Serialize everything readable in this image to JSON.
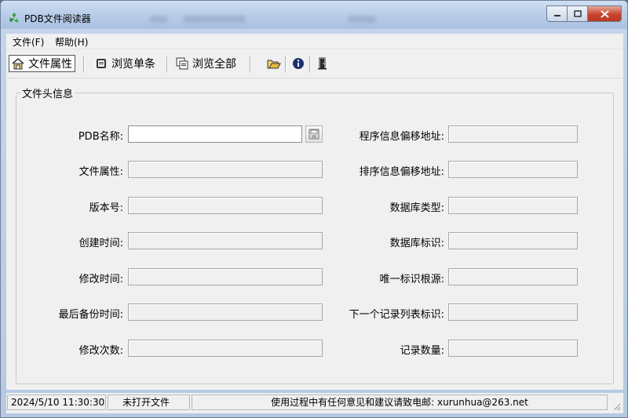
{
  "window": {
    "title": "PDB文件阅读器"
  },
  "menu": {
    "file": "文件(F)",
    "help": "帮助(H)"
  },
  "toolbar": {
    "file_attr": "文件属性",
    "browse_single": "浏览单条",
    "browse_all": "浏览全部"
  },
  "group": {
    "title": "文件头信息"
  },
  "left_fields": [
    {
      "label": "PDB名称:",
      "value": ""
    },
    {
      "label": "文件属性:",
      "value": ""
    },
    {
      "label": "版本号:",
      "value": ""
    },
    {
      "label": "创建时间:",
      "value": ""
    },
    {
      "label": "修改时间:",
      "value": ""
    },
    {
      "label": "最后备份时间:",
      "value": ""
    },
    {
      "label": "修改次数:",
      "value": ""
    }
  ],
  "right_fields": [
    {
      "label": "程序信息偏移地址:",
      "value": ""
    },
    {
      "label": "排序信息偏移地址:",
      "value": ""
    },
    {
      "label": "数据库类型:",
      "value": ""
    },
    {
      "label": "数据库标识:",
      "value": ""
    },
    {
      "label": "唯一标识根源:",
      "value": ""
    },
    {
      "label": "下一个记录列表标识:",
      "value": ""
    },
    {
      "label": "记录数量:",
      "value": ""
    }
  ],
  "status": {
    "datetime": "2024/5/10 11:30:30",
    "file_state": "未打开文件",
    "message": "使用过程中有任何意见和建议请致电邮: xurunhua@263.net"
  },
  "icons": [
    "recycle-icon",
    "minimize-icon",
    "maximize-icon",
    "close-icon",
    "file-attr-icon",
    "single-record-icon",
    "all-records-icon",
    "open-folder-icon",
    "info-icon",
    "exit-icon",
    "save-icon",
    "resize-grip-icon"
  ]
}
